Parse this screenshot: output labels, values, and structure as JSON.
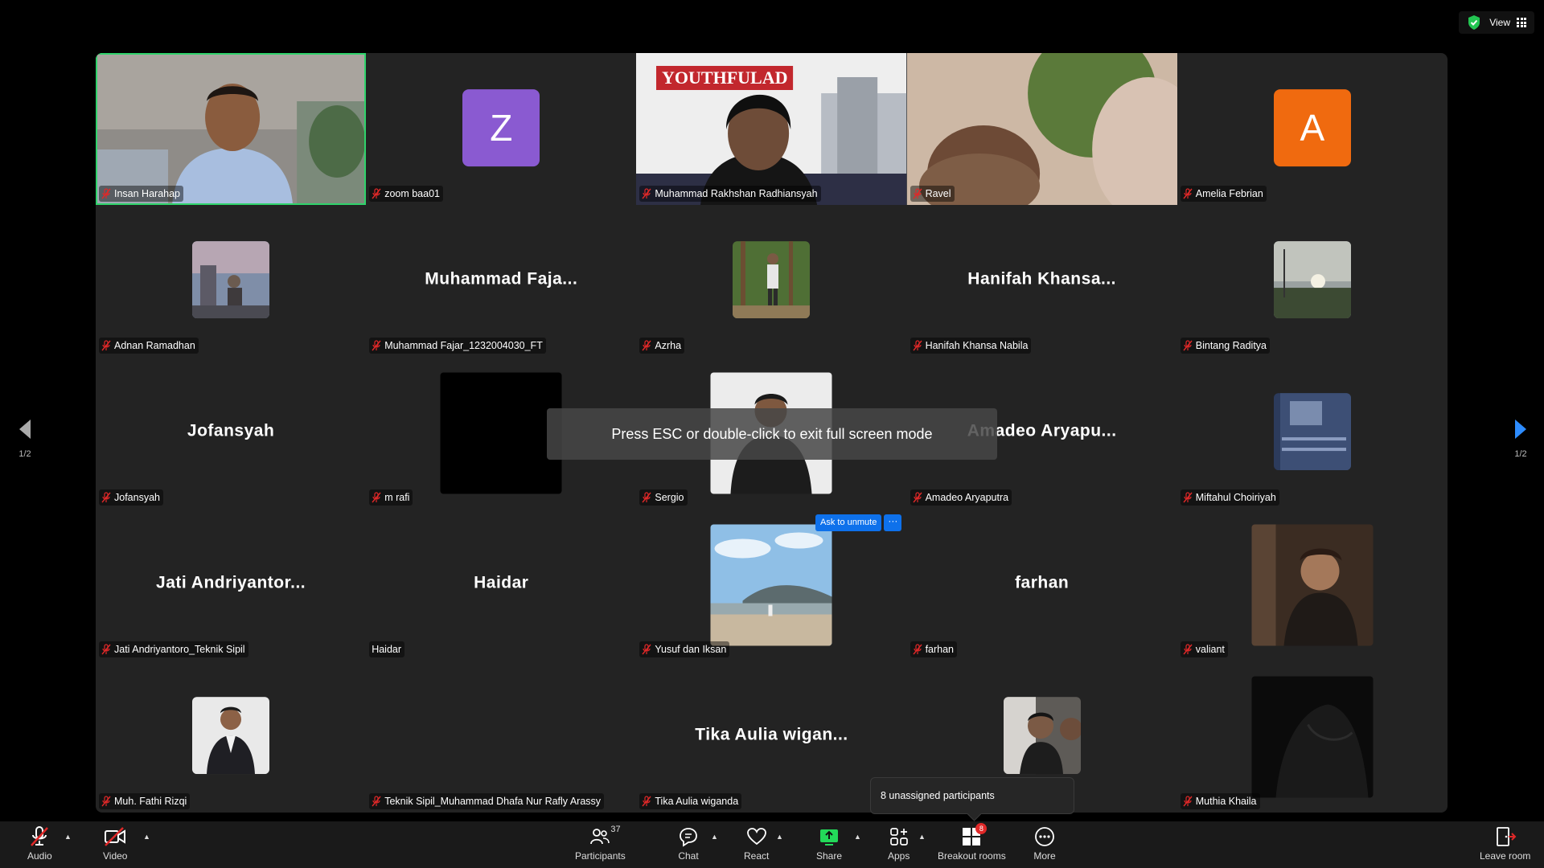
{
  "top": {
    "view_label": "View"
  },
  "tiles": [
    {
      "name": "Insan Harahap",
      "kind": "video-insan",
      "active": true
    },
    {
      "name": "zoom baa01",
      "kind": "avatar",
      "initial": "Z",
      "color": "#8a5ad1"
    },
    {
      "name": "Muhammad Rakhshan Radhiansyah",
      "kind": "video-rakhshan",
      "banner": "YOUTHFULAD"
    },
    {
      "name": "Ravel",
      "kind": "video-ravel"
    },
    {
      "name": "Amelia Febrian",
      "kind": "avatar",
      "initial": "A",
      "color": "#f06a0f"
    },
    {
      "name": "Adnan Ramadhan",
      "kind": "thumb-adnan"
    },
    {
      "name": "Muhammad Fajar_1232004030_FT",
      "kind": "bigname",
      "display": "Muhammad  Faja..."
    },
    {
      "name": "Azrha",
      "kind": "thumb-azrha"
    },
    {
      "name": "Hanifah Khansa Nabila",
      "kind": "bigname",
      "display": "Hanifah  Khansa..."
    },
    {
      "name": "Bintang Raditya",
      "kind": "thumb-bintang"
    },
    {
      "name": "Jofansyah",
      "kind": "bigname",
      "display": "Jofansyah"
    },
    {
      "name": "m rafi",
      "kind": "big-black"
    },
    {
      "name": "Sergio",
      "kind": "big-sergio"
    },
    {
      "name": "Amadeo Aryaputra",
      "kind": "bigname",
      "display": "Amadeo  Aryapu..."
    },
    {
      "name": "Miftahul Choiriyah",
      "kind": "thumb-miftahul"
    },
    {
      "name": "Jati Andriyantoro_Teknik Sipil",
      "kind": "bigname",
      "display": "Jati  Andriyantor..."
    },
    {
      "name": "Haidar",
      "kind": "bigname",
      "display": "Haidar",
      "unmuted": true
    },
    {
      "name": "Yusuf dan Iksan",
      "kind": "big-yusuf"
    },
    {
      "name": "farhan",
      "kind": "bigname",
      "display": "farhan"
    },
    {
      "name": "valiant",
      "kind": "big-valiant"
    },
    {
      "name": "Muh. Fathi Rizqi",
      "kind": "thumb-fathi"
    },
    {
      "name": "Teknik Sipil_Muhammad Dhafa Nur Rafly Arassy",
      "kind": "empty"
    },
    {
      "name": "Tika Aulia wiganda",
      "kind": "bigname",
      "display": "Tika  Aulia  wigan..."
    },
    {
      "name": "",
      "kind": "thumb-unknown",
      "nolabel": true
    },
    {
      "name": "Muthia Khaila",
      "kind": "big-muthia"
    }
  ],
  "page_indicator": {
    "left": "1/2",
    "right": "1/2"
  },
  "toast": "Press ESC or double-click to exit full screen mode",
  "ask_unmute": {
    "label": "Ask to unmute",
    "more": "···"
  },
  "breakout_tip": "8 unassigned participants",
  "toolbar": {
    "audio": "Audio",
    "video": "Video",
    "participants": "Participants",
    "participants_count": "37",
    "chat": "Chat",
    "react": "React",
    "share": "Share",
    "apps": "Apps",
    "breakout": "Breakout rooms",
    "breakout_badge": "8",
    "more": "More",
    "leave": "Leave room"
  },
  "colors": {
    "accent": "#0e71eb",
    "active_border": "#2fd36b",
    "muted": "#e02828",
    "share": "#23d959"
  }
}
